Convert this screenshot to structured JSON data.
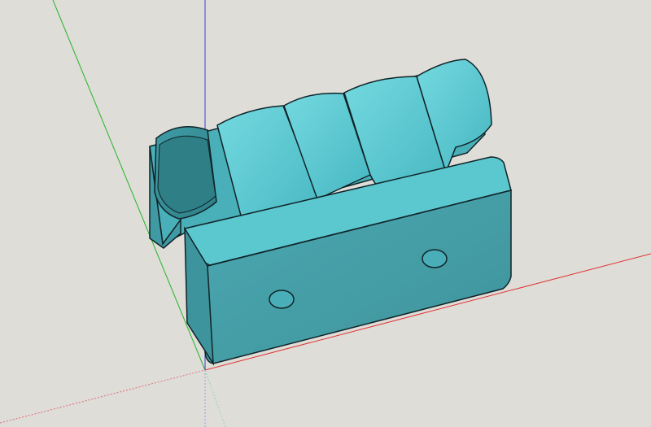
{
  "viewport": {
    "background": "#deddd8"
  },
  "axes": {
    "red": "#e03434",
    "green": "#25b425",
    "blue": "#3a3ad8"
  },
  "model": {
    "name": "hinge",
    "face_color": "#5bc7cf",
    "side_color": "#3e9ca6",
    "dark_color": "#2d7f88",
    "outline_color": "#0d1f23"
  }
}
